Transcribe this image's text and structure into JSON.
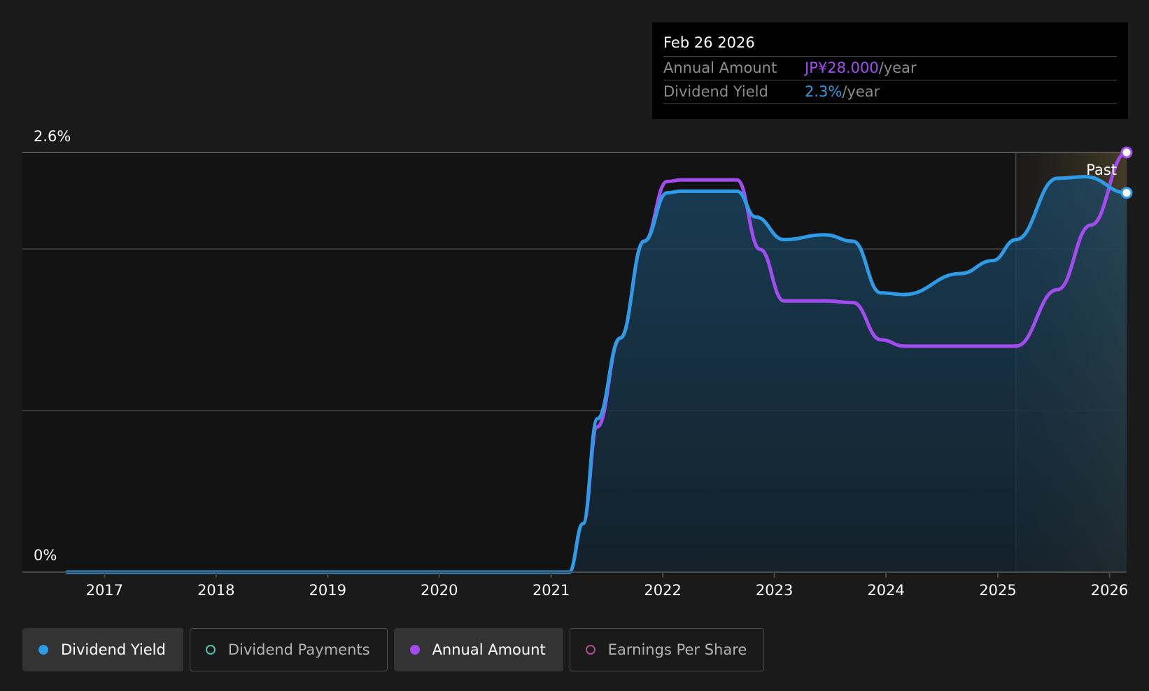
{
  "chart_data": {
    "type": "area",
    "y_top_label": "2.6%",
    "y_bottom_label": "0%",
    "ylim": [
      0,
      2.6
    ],
    "xlim": [
      "2016-09-01",
      "2026-02-26"
    ],
    "x_ticks": [
      "2017",
      "2018",
      "2019",
      "2020",
      "2021",
      "2022",
      "2023",
      "2024",
      "2025",
      "2026"
    ],
    "grid": true,
    "past_label": "Past",
    "forecast_start": "2025-03-01",
    "series": [
      {
        "name": "Dividend Yield",
        "color": "#2e9be6",
        "filled": true,
        "points": [
          [
            "2016-09-01",
            0
          ],
          [
            "2021-03-01",
            0
          ],
          [
            "2021-04-15",
            0.3
          ],
          [
            "2021-06-01",
            0.95
          ],
          [
            "2021-08-15",
            1.45
          ],
          [
            "2021-11-01",
            2.05
          ],
          [
            "2022-01-15",
            2.35
          ],
          [
            "2022-03-01",
            2.36
          ],
          [
            "2022-09-01",
            2.36
          ],
          [
            "2022-11-01",
            2.2
          ],
          [
            "2023-02-01",
            2.06
          ],
          [
            "2023-06-15",
            2.09
          ],
          [
            "2023-09-15",
            2.05
          ],
          [
            "2023-12-15",
            1.73
          ],
          [
            "2024-03-01",
            1.72
          ],
          [
            "2024-09-01",
            1.85
          ],
          [
            "2024-12-15",
            1.93
          ],
          [
            "2025-03-01",
            2.06
          ],
          [
            "2025-07-15",
            2.44
          ],
          [
            "2025-10-15",
            2.45
          ],
          [
            "2026-02-26",
            2.35
          ]
        ]
      },
      {
        "name": "Annual Amount",
        "color": "#a24cf0",
        "filled": false,
        "points": [
          [
            "2016-09-01",
            0
          ],
          [
            "2021-03-01",
            0
          ],
          [
            "2021-04-15",
            0.3
          ],
          [
            "2021-06-01",
            0.9
          ],
          [
            "2021-08-15",
            1.45
          ],
          [
            "2021-11-01",
            2.05
          ],
          [
            "2022-01-15",
            2.42
          ],
          [
            "2022-03-01",
            2.43
          ],
          [
            "2022-09-01",
            2.43
          ],
          [
            "2022-11-15",
            2.0
          ],
          [
            "2023-02-01",
            1.68
          ],
          [
            "2023-06-15",
            1.68
          ],
          [
            "2023-09-15",
            1.67
          ],
          [
            "2023-12-15",
            1.44
          ],
          [
            "2024-03-01",
            1.4
          ],
          [
            "2024-09-01",
            1.4
          ],
          [
            "2025-03-01",
            1.4
          ],
          [
            "2025-07-15",
            1.75
          ],
          [
            "2025-11-01",
            2.15
          ],
          [
            "2026-02-26",
            2.6
          ]
        ]
      }
    ],
    "tooltip": {
      "date": "Feb 26 2026",
      "rows": [
        {
          "label": "Annual Amount",
          "value": "JP¥28.000",
          "unit": "/year",
          "color": "#a24cf0"
        },
        {
          "label": "Dividend Yield",
          "value": "2.3%",
          "unit": "/year",
          "color": "#2e9be6"
        }
      ]
    }
  },
  "legend": [
    {
      "label": "Dividend Yield",
      "color": "#2e9be6",
      "active": true
    },
    {
      "label": "Dividend Payments",
      "color": "#56c2b0",
      "active": false
    },
    {
      "label": "Annual Amount",
      "color": "#a24cf0",
      "active": true
    },
    {
      "label": "Earnings Per Share",
      "color": "#b04f8c",
      "active": false
    }
  ]
}
